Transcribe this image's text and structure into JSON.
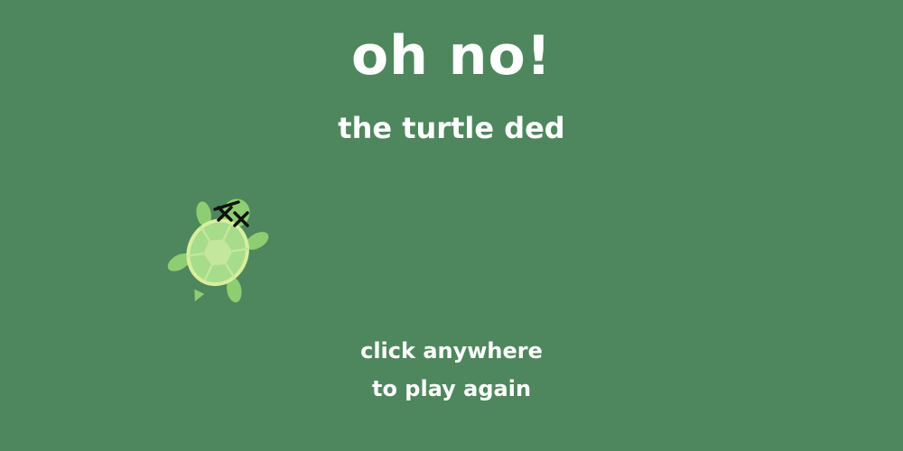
{
  "game": {
    "title": "oh no!",
    "subtitle": "the turtle ded",
    "prompt_line1": "click anywhere",
    "prompt_line2": "to play again"
  },
  "sprite": {
    "icon": "dead-turtle-icon"
  },
  "colors": {
    "background": "#4e875d",
    "text": "#ffffff",
    "turtle_limb": "#8fcd73",
    "turtle_shell": "#a6dc8a",
    "turtle_shell_rim": "#d8ef9d",
    "turtle_shell_center": "#c3e79d",
    "dead_eyes": "#111111"
  }
}
